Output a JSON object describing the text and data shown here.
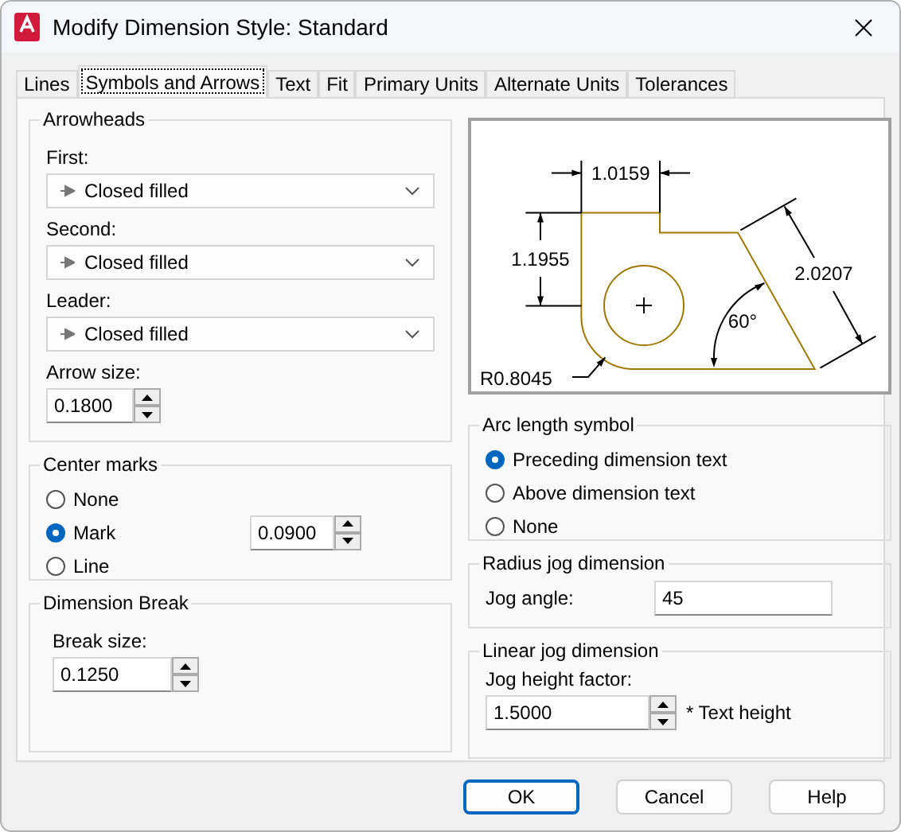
{
  "window": {
    "title": "Modify Dimension Style: Standard"
  },
  "tabs": [
    {
      "label": "Lines",
      "selected": false
    },
    {
      "label": "Symbols and Arrows",
      "selected": true
    },
    {
      "label": "Text",
      "selected": false
    },
    {
      "label": "Fit",
      "selected": false
    },
    {
      "label": "Primary Units",
      "selected": false
    },
    {
      "label": "Alternate Units",
      "selected": false
    },
    {
      "label": "Tolerances",
      "selected": false
    }
  ],
  "arrowheads": {
    "title": "Arrowheads",
    "fields": [
      {
        "label": "First:",
        "value": "Closed filled"
      },
      {
        "label": "Second:",
        "value": "Closed filled"
      },
      {
        "label": "Leader:",
        "value": "Closed filled"
      }
    ],
    "arrow_size": {
      "label": "Arrow size:",
      "value": "0.1800"
    }
  },
  "center_marks": {
    "title": "Center marks",
    "options": [
      {
        "label": "None",
        "selected": false
      },
      {
        "label": "Mark",
        "selected": true
      },
      {
        "label": "Line",
        "selected": false
      }
    ],
    "size": "0.0900"
  },
  "dimension_break": {
    "title": "Dimension Break",
    "label": "Break size:",
    "value": "0.1250"
  },
  "preview": {
    "labels": [
      "1.0159",
      "1.1955",
      "2.0207",
      "60°",
      "R0.8045"
    ]
  },
  "arc_length_symbol": {
    "title": "Arc length symbol",
    "options": [
      {
        "label": "Preceding dimension text",
        "selected": true
      },
      {
        "label": "Above dimension text",
        "selected": false
      },
      {
        "label": "None",
        "selected": false
      }
    ]
  },
  "radius_jog": {
    "title": "Radius jog dimension",
    "label": "Jog angle:",
    "value": "45"
  },
  "linear_jog": {
    "title": "Linear jog dimension",
    "label": "Jog height factor:",
    "value": "1.5000",
    "suffix": "* Text height"
  },
  "buttons": [
    {
      "label": "OK",
      "default": true
    },
    {
      "label": "Cancel",
      "default": false
    },
    {
      "label": "Help",
      "default": false
    }
  ]
}
